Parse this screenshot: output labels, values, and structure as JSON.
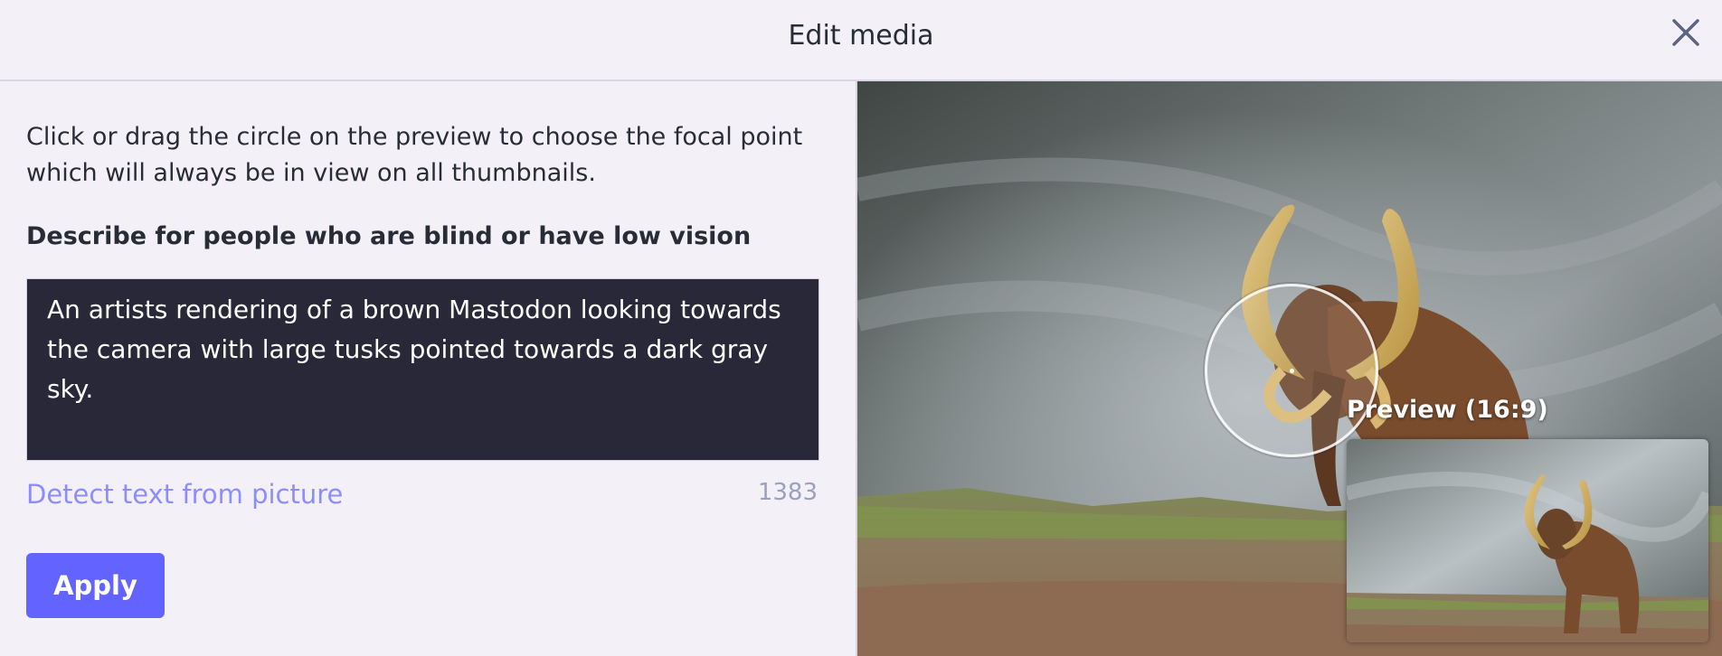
{
  "header": {
    "title": "Edit media",
    "close_icon": "close-icon"
  },
  "left": {
    "hint": "Click or drag the circle on the preview to choose the focal point which will always be in view on all thumbnails.",
    "description_label": "Describe for people who are blind or have low vision",
    "description_value": "An artists rendering of a brown Mastodon looking towards the camera with large tusks pointed towards a dark gray sky.",
    "detect_link": "Detect text from picture",
    "char_count": "1383",
    "apply_label": "Apply"
  },
  "right": {
    "preview_label": "Preview (16:9)"
  },
  "colors": {
    "accent": "#6364ff",
    "link": "#8c8dff",
    "textarea_bg": "#282838",
    "page_bg": "#f3f1f7"
  }
}
